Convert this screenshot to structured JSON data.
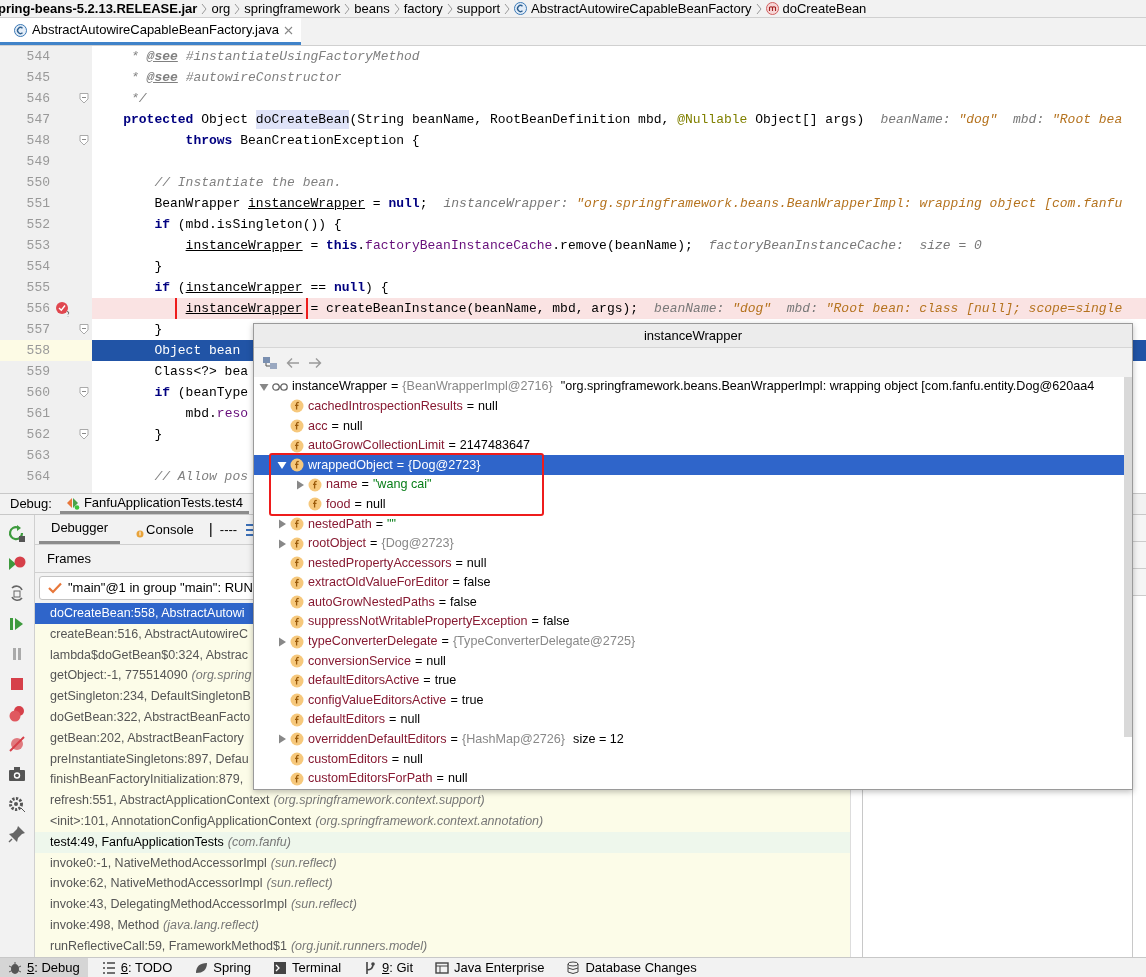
{
  "breadcrumbs": [
    {
      "label": "pring-beans-5.2.13.RELEASE.jar",
      "kind": "jar"
    },
    {
      "label": "org",
      "kind": "package"
    },
    {
      "label": "springframework",
      "kind": "package"
    },
    {
      "label": "beans",
      "kind": "package"
    },
    {
      "label": "factory",
      "kind": "package"
    },
    {
      "label": "support",
      "kind": "package"
    },
    {
      "label": "AbstractAutowireCapableBeanFactory",
      "kind": "class"
    },
    {
      "label": "doCreateBean",
      "kind": "method"
    }
  ],
  "editor_tabs": [
    {
      "label": "AbstractAutowireCapableBeanFactory.java",
      "selected": true
    }
  ],
  "code_lines": [
    {
      "number": "544",
      "fold": false,
      "breakpoint": false,
      "current": false,
      "tokens": [
        {
          "kind": "comment",
          "text": "* "
        },
        {
          "kind": "doctag",
          "text": "@see"
        },
        {
          "kind": "comment",
          "text": " #instantiateUsingFactoryMethod"
        }
      ]
    },
    {
      "number": "545",
      "fold": false,
      "breakpoint": false,
      "current": false,
      "tokens": [
        {
          "kind": "comment",
          "text": "* "
        },
        {
          "kind": "doctag",
          "text": "@see"
        },
        {
          "kind": "comment",
          "text": " #autowireConstructor"
        }
      ]
    },
    {
      "number": "546",
      "fold": true,
      "breakpoint": false,
      "current": false,
      "tokens": [
        {
          "kind": "comment",
          "text": "*/"
        }
      ]
    },
    {
      "number": "547",
      "fold": false,
      "breakpoint": false,
      "current": false,
      "tokens": [
        {
          "kind": "keyword",
          "text": "protected"
        },
        {
          "kind": "plain",
          "text": " Object "
        },
        {
          "kind": "declaration",
          "text": "doCreateBean"
        },
        {
          "kind": "plain",
          "text": "(String beanName, RootBeanDefinition mbd, "
        },
        {
          "kind": "annotation",
          "text": "@Nullable"
        },
        {
          "kind": "plain",
          "text": " Object[] args)"
        },
        {
          "kind": "hint",
          "text": "beanName: "
        },
        {
          "kind": "hint_value",
          "text": "\"dog\""
        },
        {
          "kind": "hint",
          "text": "  mbd: "
        },
        {
          "kind": "hint_value",
          "text": "\"Root bea"
        }
      ]
    },
    {
      "number": "548",
      "fold": true,
      "breakpoint": false,
      "current": false,
      "tokens": [
        {
          "kind": "keyword",
          "text": "throws"
        },
        {
          "kind": "plain",
          "text": " BeanCreationException {"
        }
      ]
    },
    {
      "number": "549",
      "fold": false,
      "breakpoint": false,
      "current": false
    },
    {
      "number": "550",
      "fold": false,
      "breakpoint": false,
      "current": false,
      "tokens": [
        {
          "kind": "comment",
          "text": "// Instantiate the bean."
        }
      ]
    },
    {
      "number": "551",
      "fold": false,
      "breakpoint": false,
      "current": false,
      "tokens": [
        {
          "kind": "plain",
          "text": "BeanWrapper "
        },
        {
          "kind": "reassigned",
          "text": "instanceWrapper"
        },
        {
          "kind": "plain",
          "text": " = "
        },
        {
          "kind": "keyword",
          "text": "null"
        },
        {
          "kind": "plain",
          "text": ";"
        },
        {
          "kind": "hint",
          "text": "instanceWrapper: "
        },
        {
          "kind": "hint_value",
          "text": "\"org.springframework.beans.BeanWrapperImpl: wrapping object [com.fanfu"
        }
      ]
    },
    {
      "number": "552",
      "fold": false,
      "breakpoint": false,
      "current": false,
      "tokens": [
        {
          "kind": "keyword",
          "text": "if"
        },
        {
          "kind": "plain",
          "text": " (mbd.isSingleton()) {"
        }
      ]
    },
    {
      "number": "553",
      "fold": false,
      "breakpoint": false,
      "current": false,
      "tokens": [
        {
          "kind": "reassigned",
          "text": "instanceWrapper"
        },
        {
          "kind": "plain",
          "text": " = "
        },
        {
          "kind": "keyword",
          "text": "this"
        },
        {
          "kind": "plain",
          "text": "."
        },
        {
          "kind": "field",
          "text": "factoryBeanInstanceCache"
        },
        {
          "kind": "plain",
          "text": ".remove(beanName);"
        },
        {
          "kind": "hint",
          "text": "factoryBeanInstanceCache:  size = 0"
        }
      ]
    },
    {
      "number": "554",
      "fold": false,
      "breakpoint": false,
      "current": false,
      "tokens": [
        {
          "kind": "plain",
          "text": "}"
        }
      ]
    },
    {
      "number": "555",
      "fold": false,
      "breakpoint": false,
      "current": false,
      "tokens": [
        {
          "kind": "keyword",
          "text": "if"
        },
        {
          "kind": "plain",
          "text": " ("
        },
        {
          "kind": "reassigned",
          "text": "instanceWrapper"
        },
        {
          "kind": "plain",
          "text": " == "
        },
        {
          "kind": "keyword",
          "text": "null"
        },
        {
          "kind": "plain",
          "text": ") {"
        }
      ]
    },
    {
      "number": "556",
      "fold": false,
      "breakpoint": true,
      "current": false,
      "tokens": [
        {
          "kind": "reassigned",
          "text": "instanceWrapper",
          "boxed": true
        },
        {
          "kind": "plain",
          "text": " = createBeanInstance(beanName, mbd, args);"
        },
        {
          "kind": "hint",
          "text": "beanName: "
        },
        {
          "kind": "hint_value",
          "text": "\"dog\""
        },
        {
          "kind": "hint",
          "text": "  mbd: "
        },
        {
          "kind": "hint_value",
          "text": "\"Root bean: class [null]; scope=single"
        }
      ]
    },
    {
      "number": "557",
      "fold": true,
      "breakpoint": false,
      "current": false,
      "tokens": [
        {
          "kind": "plain",
          "text": "}"
        }
      ]
    },
    {
      "number": "558",
      "fold": false,
      "breakpoint": false,
      "current": true,
      "tokens": [
        {
          "kind": "plain",
          "text": "Object bean"
        }
      ]
    },
    {
      "number": "559",
      "fold": false,
      "breakpoint": false,
      "current": false,
      "tokens": [
        {
          "kind": "plain",
          "text": "Class<?> bea"
        }
      ]
    },
    {
      "number": "560",
      "fold": true,
      "breakpoint": false,
      "current": false,
      "tokens": [
        {
          "kind": "keyword",
          "text": "if"
        },
        {
          "kind": "plain",
          "text": " (beanType"
        }
      ]
    },
    {
      "number": "561",
      "fold": false,
      "breakpoint": false,
      "current": false,
      "tokens": [
        {
          "kind": "plain",
          "text": "mbd."
        },
        {
          "kind": "field",
          "text": "reso"
        }
      ]
    },
    {
      "number": "562",
      "fold": true,
      "breakpoint": false,
      "current": false,
      "tokens": [
        {
          "kind": "plain",
          "text": "}"
        }
      ]
    },
    {
      "number": "563",
      "fold": false,
      "breakpoint": false,
      "current": false
    },
    {
      "number": "564",
      "fold": false,
      "breakpoint": false,
      "current": false,
      "tokens": [
        {
          "kind": "comment",
          "text": "// Allow pos"
        }
      ]
    }
  ],
  "debug": {
    "title": "Debug:",
    "session_tabs": [
      {
        "label": "FanfuApplicationTests.test4",
        "selected": true
      }
    ],
    "panel_tabs": [
      {
        "label": "Debugger",
        "selected": true
      },
      {
        "label": "Console",
        "selected": false
      }
    ],
    "console_status": "----",
    "frames_title": "Frames",
    "thread": "\"main\"@1 in group \"main\": RUN",
    "frames": [
      {
        "location": "doCreateBean:558, AbstractAutowi",
        "user_code": false,
        "selected": true
      },
      {
        "location": "createBean:516, AbstractAutowireC",
        "user_code": false,
        "selected": false
      },
      {
        "location": "lambda$doGetBean$0:324, Abstrac",
        "user_code": false,
        "selected": false
      },
      {
        "location": "getObject:-1, 775514090",
        "package": "(org.spring",
        "user_code": false,
        "selected": false
      },
      {
        "location": "getSingleton:234, DefaultSingletonB",
        "user_code": false,
        "selected": false
      },
      {
        "location": "doGetBean:322, AbstractBeanFacto",
        "user_code": false,
        "selected": false
      },
      {
        "location": "getBean:202, AbstractBeanFactory",
        "user_code": false,
        "selected": false
      },
      {
        "location": "preInstantiateSingletons:897, Defau",
        "user_code": false,
        "selected": false
      },
      {
        "location": "finishBeanFactoryInitialization:879,",
        "user_code": false,
        "selected": false
      },
      {
        "location": "refresh:551, AbstractApplicationContext",
        "package": "(org.springframework.context.support)",
        "user_code": false,
        "selected": false
      },
      {
        "location": "<init>:101, AnnotationConfigApplicationContext",
        "package": "(org.springframework.context.annotation)",
        "user_code": false,
        "selected": false
      },
      {
        "location": "test4:49, FanfuApplicationTests",
        "package": "(com.fanfu)",
        "user_code": true,
        "selected": false
      },
      {
        "location": "invoke0:-1, NativeMethodAccessorImpl",
        "package": "(sun.reflect)",
        "user_code": false,
        "selected": false
      },
      {
        "location": "invoke:62, NativeMethodAccessorImpl",
        "package": "(sun.reflect)",
        "user_code": false,
        "selected": false
      },
      {
        "location": "invoke:43, DelegatingMethodAccessorImpl",
        "package": "(sun.reflect)",
        "user_code": false,
        "selected": false
      },
      {
        "location": "invoke:498, Method",
        "package": "(java.lang.reflect)",
        "user_code": false,
        "selected": false
      },
      {
        "location": "runReflectiveCall:59, FrameworkMethod$1",
        "package": "(org.junit.runners.model)",
        "user_code": false,
        "selected": false
      }
    ]
  },
  "popup": {
    "title": "instanceWrapper",
    "tree": [
      {
        "name": "instanceWrapper",
        "kind": "watch",
        "assign": "=",
        "ref": "{BeanWrapperImpl@2716}",
        "value": "\"org.springframework.beans.BeanWrapperImpl: wrapping object [com.fanfu.entity.Dog@620aa4",
        "string_value": false,
        "expanded": true,
        "selected": false,
        "children": [
          {
            "name": "cachedIntrospectionResults",
            "kind": "field",
            "assign": "=",
            "value": "null",
            "string_value": false,
            "selected": false
          },
          {
            "name": "acc",
            "kind": "field",
            "assign": "=",
            "value": "null",
            "string_value": false,
            "selected": false
          },
          {
            "name": "autoGrowCollectionLimit",
            "kind": "field",
            "assign": "=",
            "value": "2147483647",
            "string_value": false,
            "selected": false
          },
          {
            "name": "wrappedObject",
            "kind": "field",
            "assign": "=",
            "ref": "{Dog@2723}",
            "expanded": true,
            "selected": true,
            "boxed": true,
            "children": [
              {
                "name": "name",
                "kind": "field",
                "assign": "=",
                "value": "\"wang cai\"",
                "string_value": true,
                "expanded": false,
                "selected": false
              },
              {
                "name": "food",
                "kind": "field",
                "assign": "=",
                "value": "null",
                "string_value": false,
                "selected": false
              }
            ]
          },
          {
            "name": "nestedPath",
            "kind": "field",
            "assign": "=",
            "value": "\"\"",
            "string_value": true,
            "expanded": false,
            "selected": false
          },
          {
            "name": "rootObject",
            "kind": "field",
            "assign": "=",
            "ref": "{Dog@2723}",
            "expanded": false,
            "selected": false
          },
          {
            "name": "nestedPropertyAccessors",
            "kind": "field",
            "assign": "=",
            "value": "null",
            "string_value": false,
            "selected": false
          },
          {
            "name": "extractOldValueForEditor",
            "kind": "field",
            "assign": "=",
            "value": "false",
            "string_value": false,
            "selected": false
          },
          {
            "name": "autoGrowNestedPaths",
            "kind": "field",
            "assign": "=",
            "value": "false",
            "string_value": false,
            "selected": false
          },
          {
            "name": "suppressNotWritablePropertyException",
            "kind": "field",
            "assign": "=",
            "value": "false",
            "string_value": false,
            "selected": false
          },
          {
            "name": "typeConverterDelegate",
            "kind": "field",
            "assign": "=",
            "ref": "{TypeConverterDelegate@2725}",
            "expanded": false,
            "selected": false
          },
          {
            "name": "conversionService",
            "kind": "field",
            "assign": "=",
            "value": "null",
            "string_value": false,
            "selected": false
          },
          {
            "name": "defaultEditorsActive",
            "kind": "field",
            "assign": "=",
            "value": "true",
            "string_value": false,
            "selected": false
          },
          {
            "name": "configValueEditorsActive",
            "kind": "field",
            "assign": "=",
            "value": "true",
            "string_value": false,
            "selected": false
          },
          {
            "name": "defaultEditors",
            "kind": "field",
            "assign": "=",
            "value": "null",
            "string_value": false,
            "selected": false
          },
          {
            "name": "overriddenDefaultEditors",
            "kind": "field",
            "assign": "=",
            "ref": "{HashMap@2726}",
            "value": "size = 12",
            "string_value": false,
            "expanded": false,
            "selected": false
          },
          {
            "name": "customEditors",
            "kind": "field",
            "assign": "=",
            "value": "null",
            "string_value": false,
            "selected": false
          },
          {
            "name": "customEditorsForPath",
            "kind": "field",
            "assign": "=",
            "value": "null",
            "string_value": false,
            "selected": false
          }
        ]
      }
    ]
  },
  "tool_windows": [
    {
      "label": "5: Debug",
      "kind": "debug",
      "mnemonic": true,
      "selected": true
    },
    {
      "label": "6: TODO",
      "kind": "todo",
      "mnemonic": true,
      "selected": false
    },
    {
      "label": "Spring",
      "kind": "spring",
      "mnemonic": false,
      "selected": false
    },
    {
      "label": "Terminal",
      "kind": "terminal",
      "mnemonic": false,
      "selected": false
    },
    {
      "label": "9: Git",
      "kind": "git",
      "mnemonic": true,
      "selected": false
    },
    {
      "label": "Java Enterprise",
      "kind": "enterprise",
      "mnemonic": false,
      "selected": false
    },
    {
      "label": "Database Changes",
      "kind": "database",
      "mnemonic": false,
      "selected": false
    }
  ]
}
